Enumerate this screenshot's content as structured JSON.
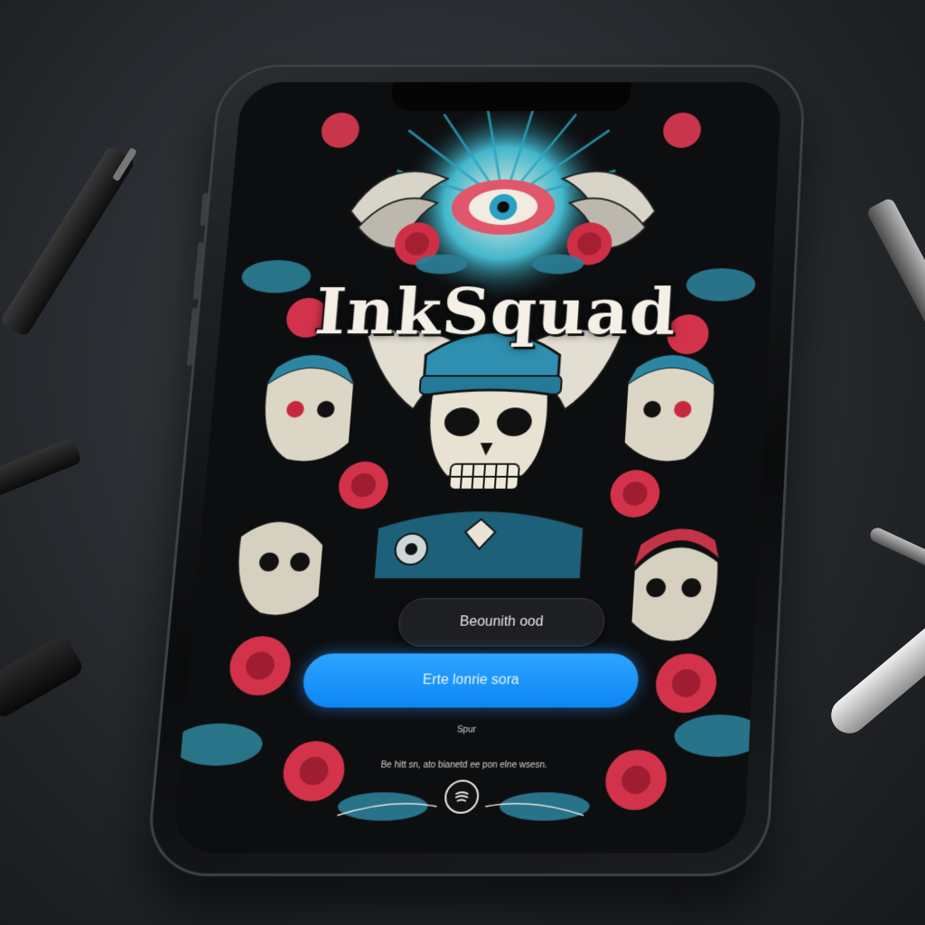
{
  "app": {
    "title": "InkSquad"
  },
  "actions": {
    "secondary_label": "Beounith ood",
    "primary_label": "Erte lonrie sora"
  },
  "footer": {
    "small_label": "Spur",
    "terms": "Be hitt sn, ato bianetd ee pon elne wsesn.",
    "bottom_icon": "app-logo-icon"
  },
  "colors": {
    "accent_blue": "#1e96ff",
    "rose_red": "#d8344a",
    "teal": "#2f8fa6",
    "bone": "#e8e2d2"
  }
}
